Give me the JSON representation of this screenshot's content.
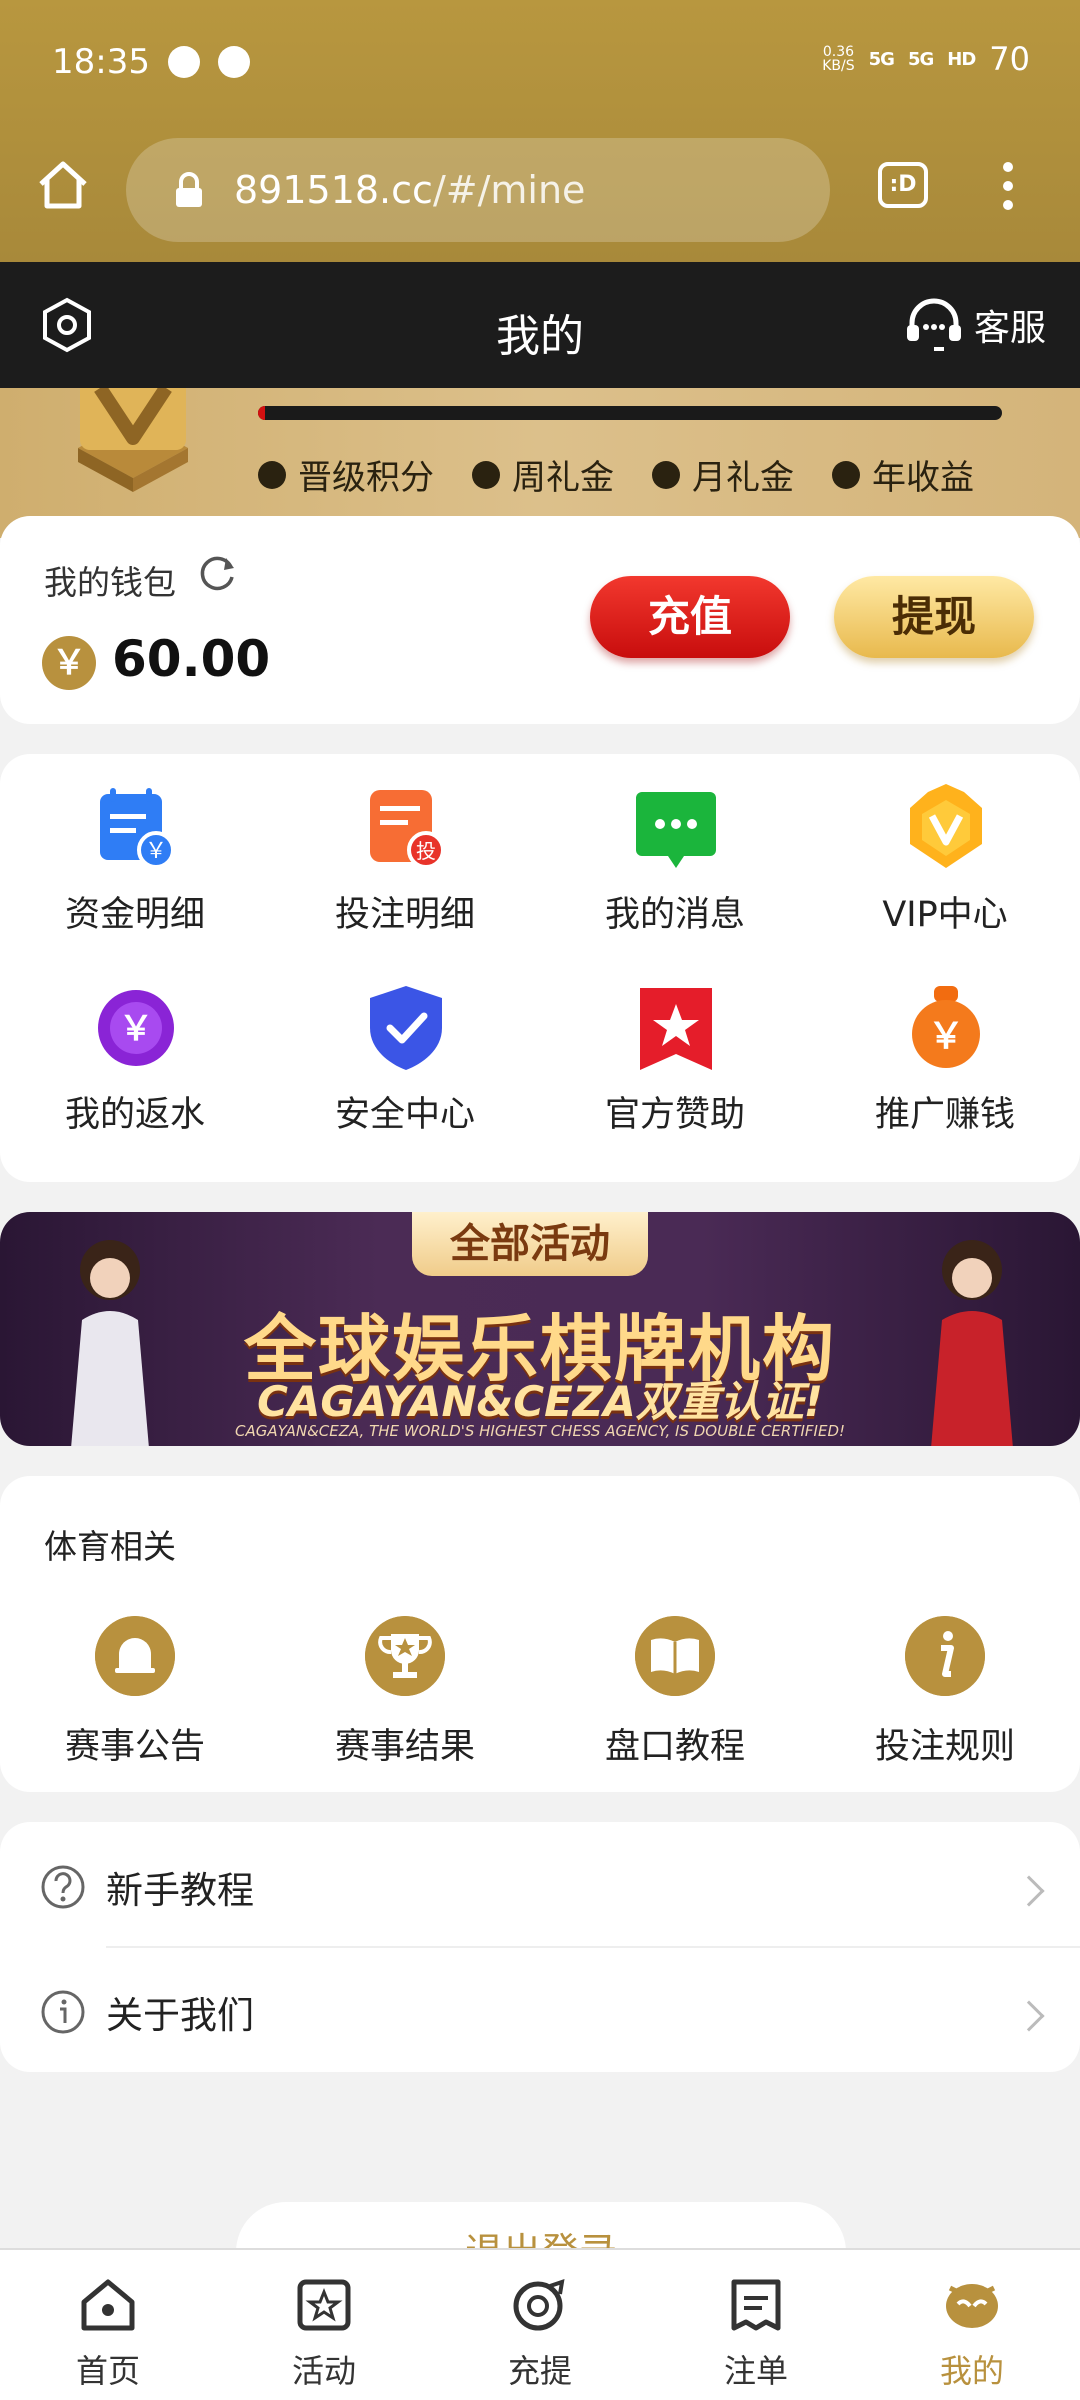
{
  "status_bar": {
    "time": "18:35",
    "speed_value": "0.36",
    "speed_unit": "KB/S",
    "network_1": "5G",
    "network_2": "5G",
    "hd": "HD",
    "battery": "70"
  },
  "browser": {
    "url_host": "891518.cc",
    "url_path": "/#/mine",
    "tab_label": ":D"
  },
  "header": {
    "title": "我的",
    "service_label": "客服"
  },
  "vip": {
    "progress": 0.01,
    "items": [
      "晋级积分",
      "周礼金",
      "月礼金",
      "年收益"
    ]
  },
  "wallet": {
    "label": "我的钱包",
    "currency_symbol": "￥",
    "balance": "60.00",
    "recharge_label": "充值",
    "withdraw_label": "提现"
  },
  "menu": {
    "items": [
      {
        "label": "资金明细",
        "icon": "fund-detail-icon"
      },
      {
        "label": "投注明细",
        "icon": "bet-detail-icon"
      },
      {
        "label": "我的消息",
        "icon": "message-icon"
      },
      {
        "label": "VIP中心",
        "icon": "vip-crown-icon"
      },
      {
        "label": "我的返水",
        "icon": "rebate-icon"
      },
      {
        "label": "安全中心",
        "icon": "shield-icon"
      },
      {
        "label": "官方赞助",
        "icon": "sponsor-star-icon"
      },
      {
        "label": "推广赚钱",
        "icon": "promote-money-icon"
      }
    ]
  },
  "banner": {
    "tag": "全部活动",
    "title": "全球娱乐棋牌机构",
    "subtitle": "CAGAYAN&CEZA双重认证!",
    "small_text": "CAGAYAN&CEZA, THE WORLD'S HIGHEST CHESS AGENCY, IS DOUBLE CERTIFIED!"
  },
  "sports": {
    "title": "体育相关",
    "items": [
      {
        "label": "赛事公告",
        "icon": "bell-icon"
      },
      {
        "label": "赛事结果",
        "icon": "trophy-icon"
      },
      {
        "label": "盘口教程",
        "icon": "book-icon"
      },
      {
        "label": "投注规则",
        "icon": "info-icon"
      }
    ]
  },
  "list": {
    "items": [
      {
        "label": "新手教程",
        "icon": "question-icon"
      },
      {
        "label": "关于我们",
        "icon": "info-circle-icon"
      }
    ]
  },
  "logout_label": "退出登录",
  "bottom_nav": {
    "items": [
      {
        "label": "首页",
        "icon": "home-icon"
      },
      {
        "label": "活动",
        "icon": "activity-icon"
      },
      {
        "label": "充提",
        "icon": "recharge-icon"
      },
      {
        "label": "注单",
        "icon": "order-icon"
      },
      {
        "label": "我的",
        "icon": "mine-icon"
      }
    ],
    "active_index": 4
  },
  "colors": {
    "gold": "#b8913e",
    "header_bg": "#1c1c1c",
    "recharge_red": "#d31010"
  }
}
